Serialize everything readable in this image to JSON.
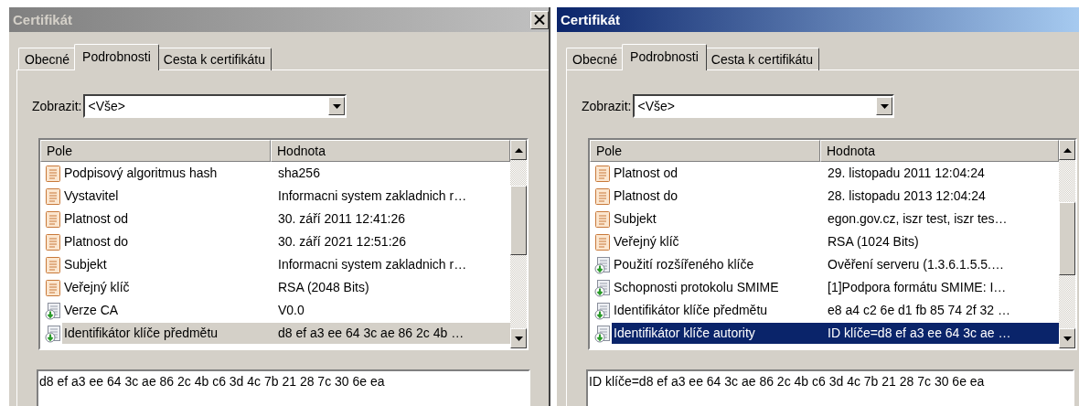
{
  "windows": [
    {
      "title": "Certifikát",
      "active": false,
      "close_button": true,
      "tabs": [
        {
          "label": "Obecné",
          "selected": false
        },
        {
          "label": "Podrobnosti",
          "selected": true
        },
        {
          "label": "Cesta k certifikátu",
          "selected": false
        }
      ],
      "show_label": "Zobrazit:",
      "show_value": "<Vše>",
      "columns": [
        "Pole",
        "Hodnota"
      ],
      "rows": [
        {
          "kind": "field",
          "name": "Podpisový algoritmus hash",
          "value": "sha256",
          "selected": false
        },
        {
          "kind": "field",
          "name": "Vystavitel",
          "value": "Informacni system zakladnich r…",
          "selected": false
        },
        {
          "kind": "field",
          "name": "Platnost od",
          "value": "30. září 2011 12:41:26",
          "selected": false
        },
        {
          "kind": "field",
          "name": "Platnost do",
          "value": "30. září 2021 12:51:26",
          "selected": false
        },
        {
          "kind": "field",
          "name": "Subjekt",
          "value": "Informacni system zakladnich r…",
          "selected": false
        },
        {
          "kind": "field",
          "name": "Veřejný klíč",
          "value": "RSA (2048 Bits)",
          "selected": false
        },
        {
          "kind": "extension",
          "name": "Verze CA",
          "value": "V0.0",
          "selected": false
        },
        {
          "kind": "extension",
          "name": "Identifikátor klíče předmětu",
          "value": "d8 ef a3 ee 64 3c ae 86 2c 4b …",
          "selected": true
        }
      ],
      "detail": "d8 ef a3 ee 64 3c ae 86 2c 4b c6 3d 4c 7b 21 28 7c 30 6e ea"
    },
    {
      "title": "Certifikát",
      "active": true,
      "close_button": false,
      "tabs": [
        {
          "label": "Obecné",
          "selected": false
        },
        {
          "label": "Podrobnosti",
          "selected": true
        },
        {
          "label": "Cesta k certifikátu",
          "selected": false
        }
      ],
      "show_label": "Zobrazit:",
      "show_value": "<Vše>",
      "columns": [
        "Pole",
        "Hodnota"
      ],
      "rows": [
        {
          "kind": "field",
          "name": "Platnost od",
          "value": "29. listopadu 2011 12:04:24",
          "selected": false
        },
        {
          "kind": "field",
          "name": "Platnost do",
          "value": "28. listopadu 2013 12:04:24",
          "selected": false
        },
        {
          "kind": "field",
          "name": "Subjekt",
          "value": "egon.gov.cz, iszr test, iszr tes…",
          "selected": false
        },
        {
          "kind": "field",
          "name": "Veřejný klíč",
          "value": "RSA (1024 Bits)",
          "selected": false
        },
        {
          "kind": "extension",
          "name": "Použití rozšířeného klíče",
          "value": "Ověření serveru (1.3.6.1.5.5.…",
          "selected": false
        },
        {
          "kind": "extension",
          "name": "Schopnosti protokolu SMIME",
          "value": "[1]Podpora formátu SMIME: I…",
          "selected": false
        },
        {
          "kind": "extension",
          "name": "Identifikátor klíče předmětu",
          "value": "e8 a4 c2 6e d1 fb 85 74 2f 32 …",
          "selected": false
        },
        {
          "kind": "extension",
          "name": "Identifikátor klíče autority",
          "value": "ID klíče=d8 ef a3 ee 64 3c ae …",
          "selected": true
        }
      ],
      "detail": "ID klíče=d8 ef a3 ee 64 3c ae 86 2c 4b c6 3d 4c 7b 21 28 7c 30 6e ea"
    }
  ]
}
